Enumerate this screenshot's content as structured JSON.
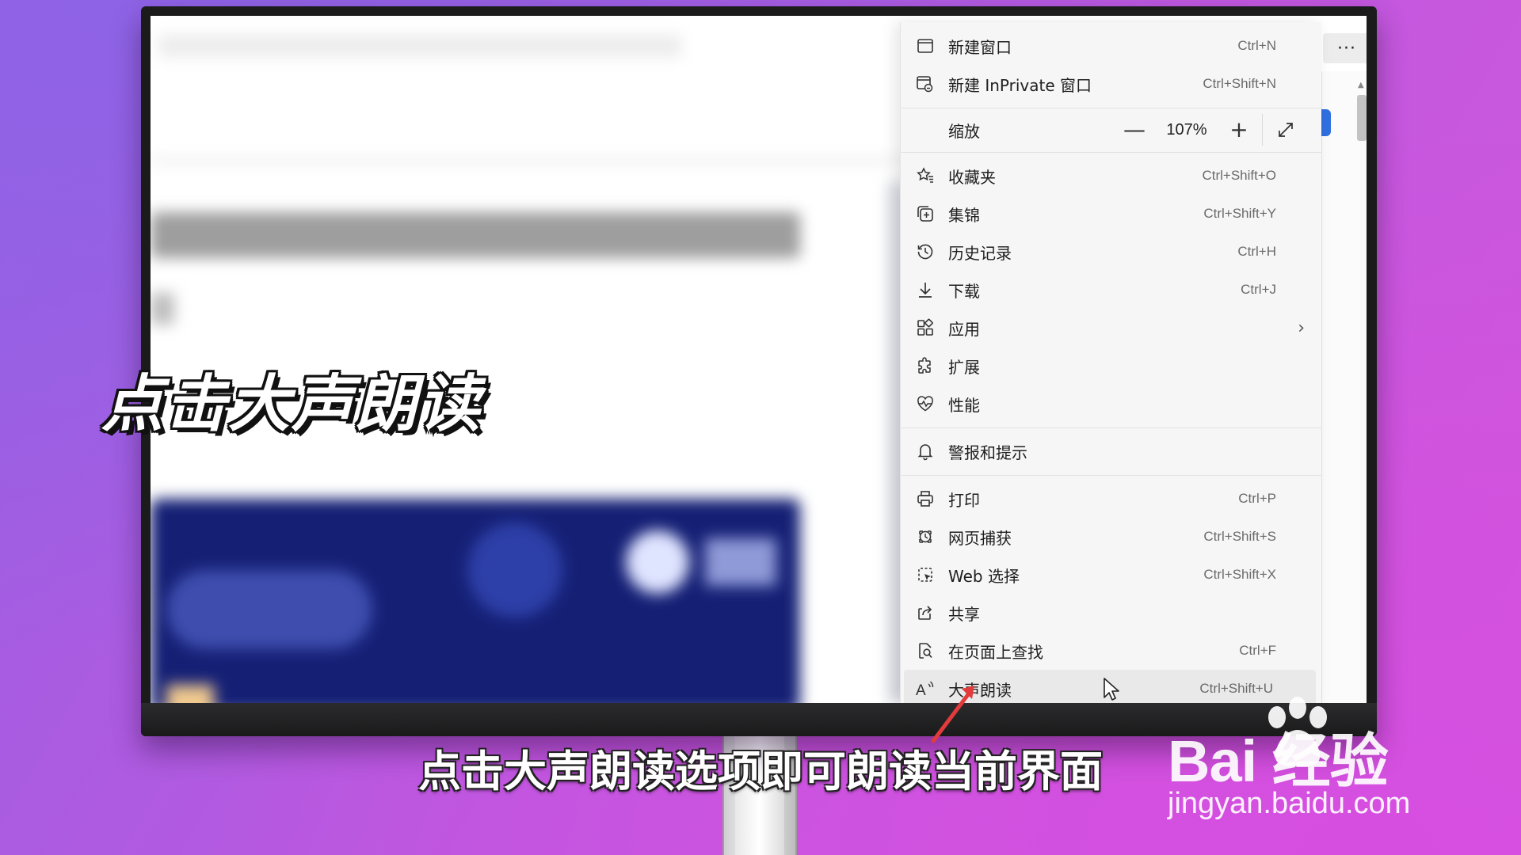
{
  "menu": {
    "new_window": {
      "label": "新建窗口",
      "shortcut": "Ctrl+N",
      "icon": "window-icon"
    },
    "new_inprivate": {
      "label": "新建 InPrivate 窗口",
      "shortcut": "Ctrl+Shift+N",
      "icon": "inprivate-window-icon"
    },
    "zoom": {
      "label": "缩放",
      "minus": "—",
      "value": "107%",
      "plus": "+",
      "icon": "fullscreen-icon"
    },
    "favorites": {
      "label": "收藏夹",
      "shortcut": "Ctrl+Shift+O",
      "icon": "favorites-icon"
    },
    "collections": {
      "label": "集锦",
      "shortcut": "Ctrl+Shift+Y",
      "icon": "collections-icon"
    },
    "history": {
      "label": "历史记录",
      "shortcut": "Ctrl+H",
      "icon": "history-icon"
    },
    "downloads": {
      "label": "下载",
      "shortcut": "Ctrl+J",
      "icon": "download-icon"
    },
    "apps": {
      "label": "应用",
      "arrow": "›",
      "icon": "apps-icon"
    },
    "extensions": {
      "label": "扩展",
      "icon": "extensions-icon"
    },
    "performance": {
      "label": "性能",
      "icon": "performance-icon"
    },
    "alerts": {
      "label": "警报和提示",
      "icon": "bell-icon"
    },
    "print": {
      "label": "打印",
      "shortcut": "Ctrl+P",
      "icon": "print-icon"
    },
    "web_capture": {
      "label": "网页捕获",
      "shortcut": "Ctrl+Shift+S",
      "icon": "web-capture-icon"
    },
    "web_select": {
      "label": "Web 选择",
      "shortcut": "Ctrl+Shift+X",
      "icon": "web-select-icon"
    },
    "share": {
      "label": "共享",
      "icon": "share-icon"
    },
    "find": {
      "label": "在页面上查找",
      "shortcut": "Ctrl+F",
      "icon": "find-icon"
    },
    "read_aloud": {
      "label": "大声朗读",
      "shortcut": "Ctrl+Shift+U",
      "icon": "read-aloud-icon"
    }
  },
  "browser": {
    "more_button": "···"
  },
  "overlay": {
    "title_caption": "点击大声朗读",
    "subtitle": "点击大声朗读选项即可朗读当前界面",
    "watermark_logo": "Bai  经验",
    "watermark_url": "jingyan.baidu.com"
  },
  "colors": {
    "background": "#b85de0",
    "menu_bg": "#f6f6f7",
    "highlight": "#e9e9ea",
    "arrow": "#e23b3b"
  }
}
